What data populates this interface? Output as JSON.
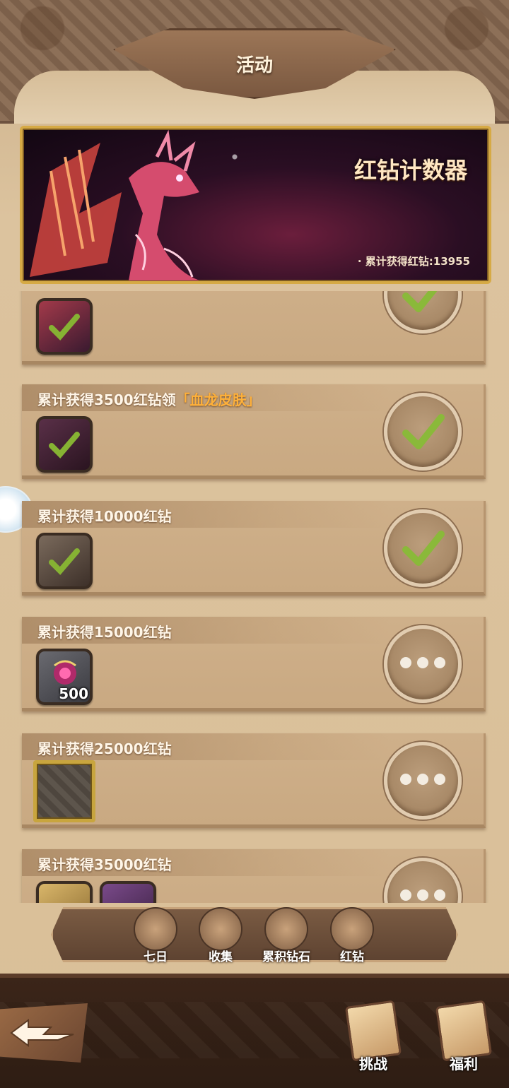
{
  "header": {
    "title": "活动"
  },
  "banner": {
    "title": "红钻计数器",
    "count_label": "· 累计获得红钻:13955"
  },
  "rewards": [
    {
      "title": "",
      "reward": "ssr-hero",
      "status": "claimed"
    },
    {
      "title_prefix": "累计获得3500红钻领",
      "title_highlight": "「血龙皮肤」",
      "reward": "skin",
      "status": "claimed"
    },
    {
      "title": "累计获得10000红钻",
      "reward": "frame-scroll",
      "status": "claimed"
    },
    {
      "title": "累计获得15000红钻",
      "reward": "red-diamond",
      "qty": "500",
      "status": "locked"
    },
    {
      "title": "累计获得25000红钻",
      "reward": "avatar-frame",
      "status": "locked"
    },
    {
      "title": "累计获得35000红钻",
      "reward": "scrolls",
      "status": "locked"
    }
  ],
  "tabs": [
    {
      "label": "七日",
      "icon": "seven-day-icon"
    },
    {
      "label": "收集",
      "icon": "book-icon"
    },
    {
      "label": "累积钻石",
      "icon": "diamond-bag-icon"
    },
    {
      "label": "红钻",
      "icon": "money-bag-icon"
    }
  ],
  "bottom": {
    "challenge_label": "挑战",
    "welfare_label": "福利"
  },
  "colors": {
    "highlight": "#ffb13a",
    "check": "#86b233",
    "frame_gold": "#d6aa45"
  }
}
